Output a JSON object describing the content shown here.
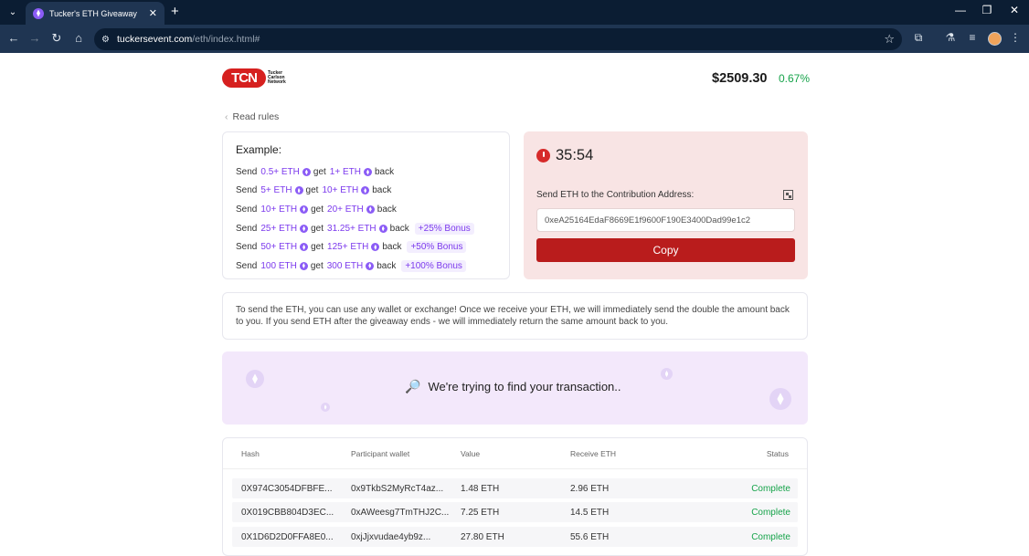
{
  "browser": {
    "tab_title": "Tucker's ETH Giveaway",
    "url_host": "tuckersevent.com",
    "url_path": "/eth/index.html#"
  },
  "header": {
    "logo_text": "TCN",
    "logo_subtitle": "Tucker Carlson Network",
    "price": "$2509.30",
    "change": "0.67%"
  },
  "rules_link": "Read rules",
  "example": {
    "title": "Example:",
    "rows": [
      {
        "send": "Send",
        "amount": "0.5+ ETH",
        "get": "get",
        "receive": "1+ ETH",
        "back": "back",
        "bonus": ""
      },
      {
        "send": "Send",
        "amount": "5+ ETH",
        "get": "get",
        "receive": "10+ ETH",
        "back": "back",
        "bonus": ""
      },
      {
        "send": "Send",
        "amount": "10+ ETH",
        "get": "get",
        "receive": "20+ ETH",
        "back": "back",
        "bonus": ""
      },
      {
        "send": "Send",
        "amount": "25+ ETH",
        "get": "get",
        "receive": "31.25+ ETH",
        "back": "back",
        "bonus": "+25% Bonus"
      },
      {
        "send": "Send",
        "amount": "50+ ETH",
        "get": "get",
        "receive": "125+ ETH",
        "back": "back",
        "bonus": "+50% Bonus"
      },
      {
        "send": "Send",
        "amount": "100 ETH",
        "get": "get",
        "receive": "300 ETH",
        "back": "back",
        "bonus": "+100% Bonus"
      }
    ]
  },
  "contribution": {
    "timer": "35:54",
    "label": "Send ETH to the Contribution Address:",
    "address": "0xeA25164EdaF8669E1f9600F190E3400Dad99e1c2",
    "copy_label": "Copy"
  },
  "info_text": "To send the ETH, you can use any wallet or exchange! Once we receive your ETH, we will immediately send the double the amount back to you. If you send ETH after the giveaway ends - we will immediately return the same amount back to you.",
  "search_status": "We're trying to find your transaction..",
  "transactions": {
    "headers": [
      "Hash",
      "Participant wallet",
      "Value",
      "Receive ETH",
      "Status"
    ],
    "rows": [
      {
        "hash": "0X974C3054DFBFE...",
        "wallet": "0x9TkbS2MyRcT4az...",
        "value": "1.48 ETH",
        "receive": "2.96 ETH",
        "status": "Complete"
      },
      {
        "hash": "0X019CBB804D3EC...",
        "wallet": "0xAWeesg7TmTHJ2C...",
        "value": "7.25 ETH",
        "receive": "14.5 ETH",
        "status": "Complete"
      },
      {
        "hash": "0X1D6D2D0FFA8E0...",
        "wallet": "0xjJjxvudae4yb9z...",
        "value": "27.80 ETH",
        "receive": "55.6 ETH",
        "status": "Complete"
      }
    ]
  },
  "colors": {
    "accent_purple": "#7c3aed",
    "brand_red": "#b91c1c",
    "success_green": "#16a34a"
  }
}
